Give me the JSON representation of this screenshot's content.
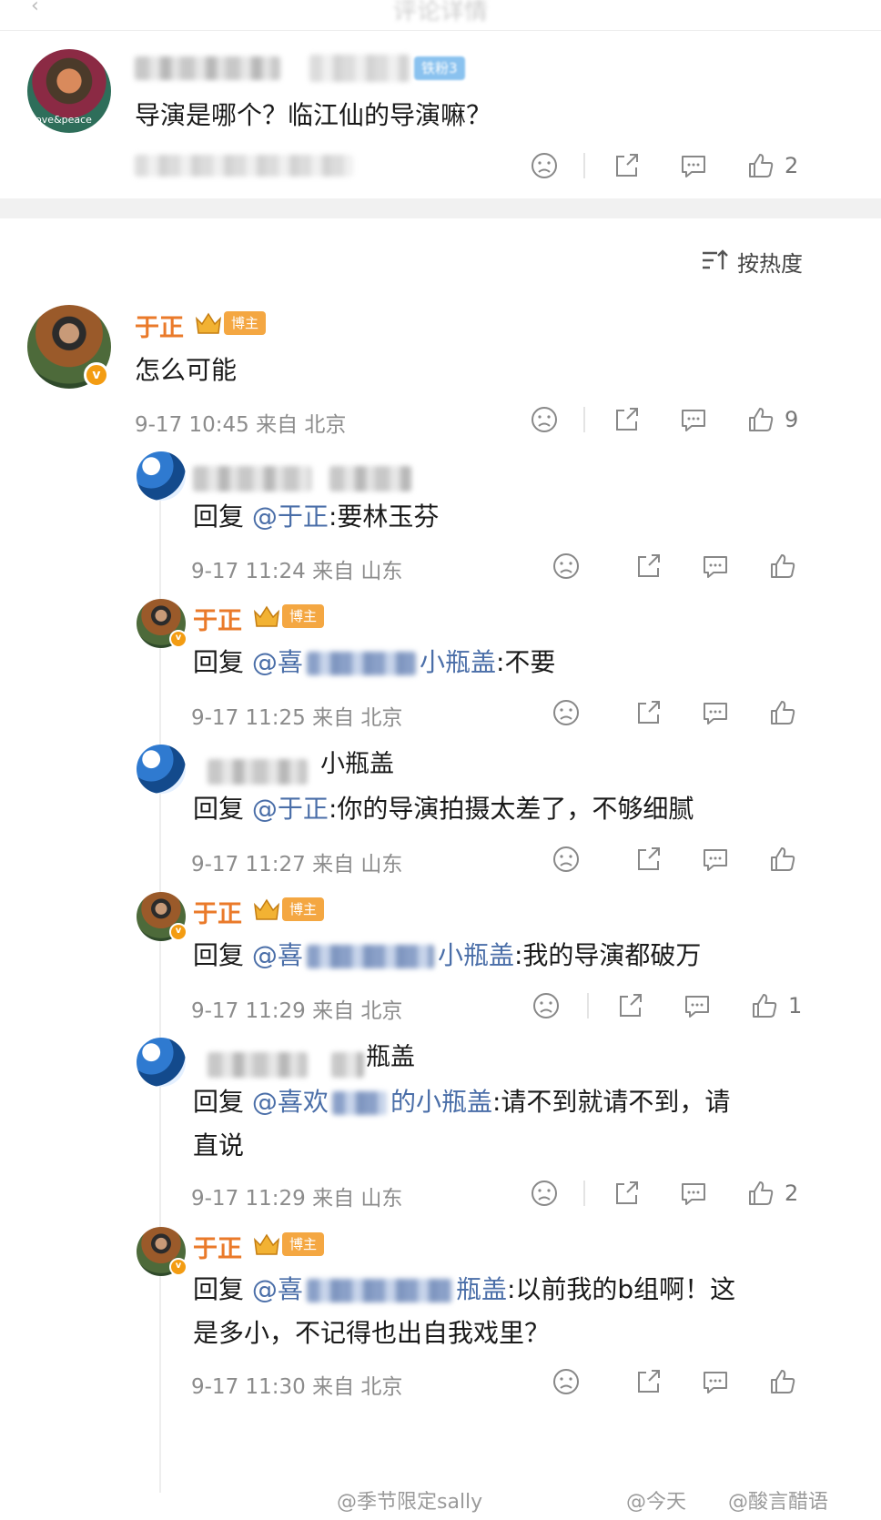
{
  "header": {
    "title": "评论详情",
    "back_icon": "back-arrow-icon"
  },
  "original_post": {
    "avatar_text": "love&peace",
    "fan_badge": "铁粉3",
    "text": "导演是哪个？临江仙的导演嘛？",
    "like_count": "2"
  },
  "sort": {
    "label": "按热度"
  },
  "host_badge": "博主",
  "main_comment": {
    "name": "于正",
    "text": "怎么可能",
    "meta": "9-17 10:45 来自 北京",
    "like_count": "9"
  },
  "replies": [
    {
      "name_visible": "",
      "reply_prefix": "回复",
      "mention": "@于正",
      "text": ":要林玉芬",
      "meta": "9-17 11:24 来自 山东",
      "like_count": ""
    },
    {
      "name_visible": "于正",
      "reply_prefix": "回复",
      "mention": "@喜",
      "mention_tail": "小瓶盖",
      "text": ":不要",
      "meta": "9-17 11:25 来自 北京",
      "like_count": ""
    },
    {
      "name_visible": "小瓶盖",
      "reply_prefix": "回复",
      "mention": "@于正",
      "text": ":你的导演拍摄太差了，不够细腻",
      "meta": "9-17 11:27 来自 山东",
      "like_count": ""
    },
    {
      "name_visible": "于正",
      "reply_prefix": "回复",
      "mention": "@喜",
      "mention_tail": "小瓶盖",
      "text": ":我的导演都破万",
      "meta": "9-17 11:29 来自 北京",
      "like_count": "1"
    },
    {
      "name_visible": "瓶盖",
      "reply_prefix": "回复",
      "mention": "@喜欢",
      "mention_tail": "的小瓶盖",
      "text": ":请不到就请不到，请",
      "text_line2": "直说",
      "meta": "9-17 11:29 来自 山东",
      "like_count": "2"
    },
    {
      "name_visible": "于正",
      "reply_prefix": "回复",
      "mention": "@喜",
      "mention_tail": "瓶盖",
      "text": ":以前我的b组啊！这",
      "text_line2": "是多小，不记得也出自我戏里？",
      "meta": "9-17 11:30 来自 北京",
      "like_count": ""
    }
  ],
  "watermarks": {
    "left": "@季节限定sally",
    "right_a": "@今天",
    "right_b": "@酸言醋语"
  },
  "colors": {
    "host_name": "#ea7a2a",
    "mention": "#4a6ea8",
    "host_badge": "#f4a742",
    "fan_badge": "#8ac2ef"
  }
}
